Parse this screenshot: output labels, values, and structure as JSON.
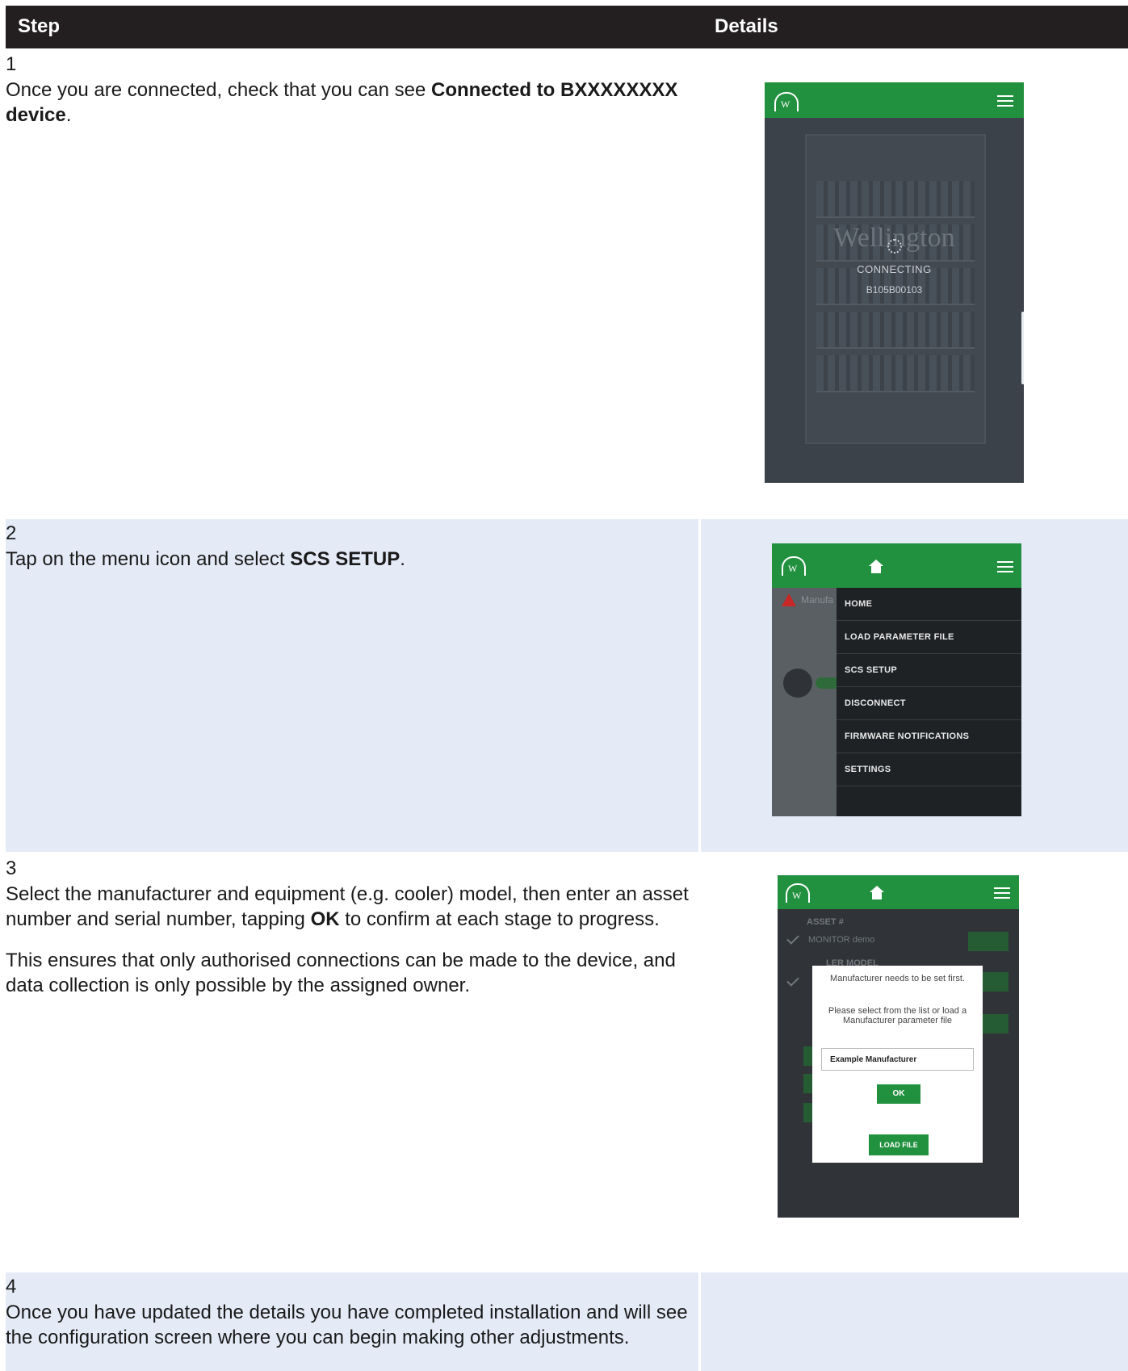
{
  "table": {
    "headers": {
      "step": "Step",
      "details": "Details"
    }
  },
  "steps": [
    {
      "number": "1",
      "text_pre": "Once you are connected, check that you can see ",
      "text_bold": "Connected to BXXXXXXXX device",
      "text_post": ".",
      "screen": {
        "brand": "Wellington",
        "status": "CONNECTING",
        "serial": "B105B00103",
        "logo_letter": "W"
      }
    },
    {
      "number": "2",
      "text_pre": "Tap on the menu icon and select ",
      "text_bold": "SCS SETUP",
      "text_post": ".",
      "screen": {
        "bg_label": "Manufa",
        "menu": [
          "HOME",
          "LOAD PARAMETER FILE",
          "SCS SETUP",
          "DISCONNECT",
          "FIRMWARE NOTIFICATIONS",
          "SETTINGS"
        ],
        "logo_letter": "W"
      }
    },
    {
      "number": "3",
      "text_pre": "Select the manufacturer and equipment (e.g. cooler) model, then enter an asset number and serial number, tapping ",
      "text_bold": "OK",
      "text_post": " to confirm at each stage to progress.",
      "text2": "This ensures that only authorised connections can be made to the device, and data collection is only possible by the assigned owner.",
      "screen": {
        "bg_asset": "ASSET #",
        "bg_monitor": "MONITOR demo",
        "bg_model": "LER MODEL",
        "dialog_line1": "Manufacturer needs to be set first.",
        "dialog_line2": "Please select from the list or load a Manufacturer parameter file",
        "selected_value": "Example Manufacturer",
        "ok_label": "OK",
        "load_label": "LOAD FILE",
        "logo_letter": "W"
      }
    },
    {
      "number": "4",
      "text": "Once you have updated the details you have completed installation and will see the configuration screen where you can begin making other adjustments."
    }
  ],
  "colors": {
    "header_bg": "#231f20",
    "row_alt": "#e4ebf7",
    "app_green": "#22913f"
  }
}
